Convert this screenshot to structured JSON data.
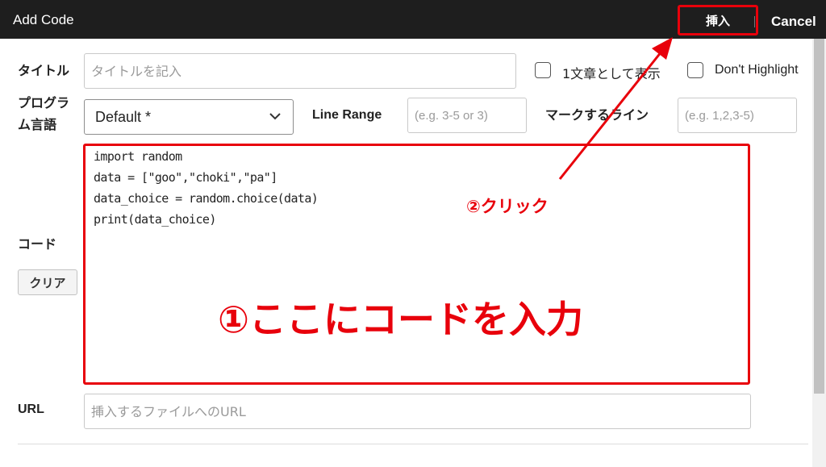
{
  "dialog": {
    "title": "Add Code",
    "insert_label": "挿入",
    "cancel_label": "Cancel"
  },
  "form": {
    "title_label": "タイトル",
    "title_placeholder": "タイトルを記入",
    "checkbox_sentence_label": "1文章として表示",
    "checkbox_sentence_checked": false,
    "checkbox_nohighlight_label": "Don't Highlight",
    "checkbox_nohighlight_checked": false,
    "language_label_line1": "プログラ",
    "language_label_line2": "ム言語",
    "language_value": "Default *",
    "line_range_label": "Line Range",
    "line_range_placeholder": "(e.g. 3-5 or 3)",
    "mark_lines_label": "マークするライン",
    "mark_lines_placeholder": "(e.g. 1,2,3-5)",
    "code_label": "コード",
    "clear_label": "クリア",
    "code_lines": [
      "import random",
      "data = [\"goo\",\"choki\",\"pa\"]",
      "data_choice = random.choice(data)",
      "print(data_choice)"
    ],
    "url_label": "URL",
    "url_placeholder": "挿入するファイルへのURL"
  },
  "annotations": {
    "step1": "①ここにコードを入力",
    "step2": "②クリック",
    "color": "#e8000b"
  },
  "colors": {
    "header_bg": "#1e1e1e",
    "accent_red": "#e8000b"
  },
  "icons": {
    "select_arrow": "chevron-down-icon",
    "annotation_arrow": "red-arrow-icon"
  }
}
